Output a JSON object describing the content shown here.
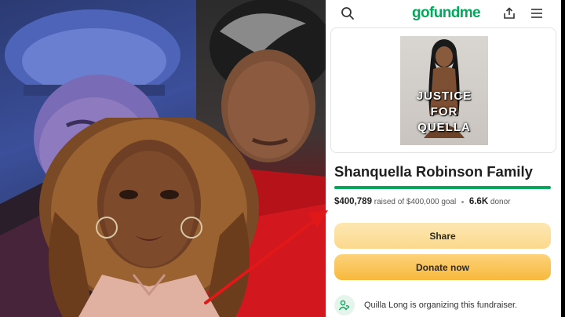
{
  "header": {
    "logo_text": "gofundme",
    "search_icon": "search-icon",
    "share_icon": "upload-share-icon",
    "menu_icon": "hamburger-menu-icon"
  },
  "campaign": {
    "cover_lines": [
      "JUSTICE",
      "FOR",
      "QUELLA"
    ],
    "title": "Shanquella Robinson Family",
    "raised_amount": "$400,789",
    "goal_text": "raised of $400,000 goal",
    "donor_count": "6.6K",
    "donor_label": "donor",
    "progress_fraction": 1.0
  },
  "actions": {
    "share_label": "Share",
    "donate_label": "Donate now"
  },
  "organizer": {
    "name": "Quilla Long",
    "text": "is organizing this fundraiser."
  },
  "colors": {
    "brand_green": "#02a95c",
    "share_button": "#fbd98c",
    "donate_button": "#f8b93c",
    "annotation_arrow": "#e01818"
  }
}
